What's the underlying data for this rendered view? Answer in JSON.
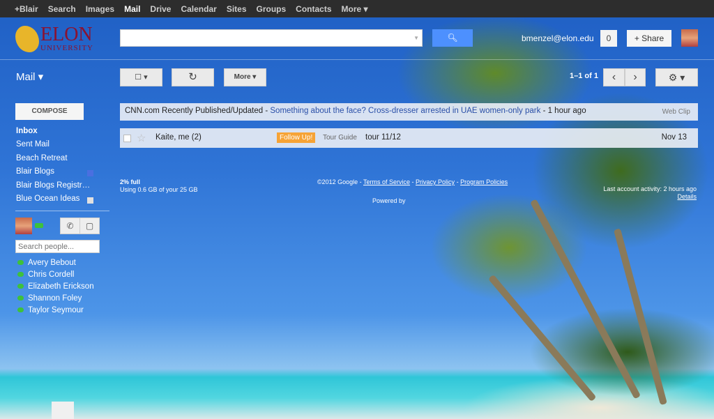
{
  "topbar": {
    "items": [
      "+Blair",
      "Search",
      "Images",
      "Mail",
      "Drive",
      "Calendar",
      "Sites",
      "Groups",
      "Contacts",
      "More ▾"
    ],
    "active": "Mail"
  },
  "logo": {
    "name": "ELON",
    "sub": "UNIVERSITY"
  },
  "header": {
    "search_value": "",
    "search_icon": "magnifier-icon",
    "email": "bmenzel@elon.edu",
    "notifications": "0",
    "share_label": "+ Share"
  },
  "toolbar": {
    "mail_label": "Mail ▾",
    "select": "☐ ▾",
    "refresh": "↻",
    "more": "More ▾",
    "pager": "1–1 of 1",
    "prev": "‹",
    "next": "›",
    "settings": "⚙ ▾"
  },
  "sidebar": {
    "compose": "COMPOSE",
    "labels": [
      {
        "label": "Inbox",
        "bold": true
      },
      {
        "label": "Sent Mail"
      },
      {
        "label": "Beach Retreat"
      },
      {
        "label": "Blair Blogs",
        "color": "#4a6fe0"
      },
      {
        "label": "Blair Blogs Registr…"
      },
      {
        "label": "Blue Ocean Ideas",
        "color": "#e0e0e0"
      }
    ]
  },
  "chat": {
    "search_placeholder": "Search people...",
    "contacts": [
      "Avery Bebout",
      "Chris Cordell",
      "Elizabeth Erickson",
      "Shannon Foley",
      "Taylor Seymour"
    ]
  },
  "webclip": {
    "source": "CNN.com Recently Published/Updated - ",
    "headline": "Something about the face? Cross-dresser arrested in UAE women-only park",
    "time": " - 1 hour ago",
    "tag": "Web Clip"
  },
  "messages": [
    {
      "sender": "Kaite, me (2)",
      "label": "Follow Up!",
      "label_color": "#f6a336",
      "category": "Tour Guide",
      "subject": "tour 11/12",
      "date": "Nov 13"
    }
  ],
  "footer": {
    "usage_pct": "2% full",
    "usage": "Using 0.6 GB of your 25 GB",
    "copyright": "©2012 Google - ",
    "terms": "Terms of Service",
    "privacy": "Privacy Policy",
    "program": "Program Policies",
    "powered": "Powered by",
    "activity": "Last account activity: 2 hours ago",
    "details": "Details"
  }
}
